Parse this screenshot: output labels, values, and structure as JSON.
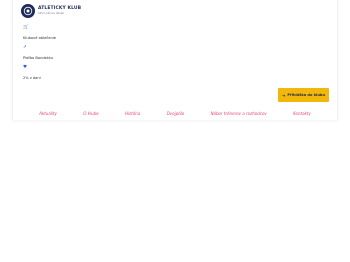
{
  "logo": {
    "title": "ATLETICKÝ KLUB",
    "subtitle": "SKV Lužnice Veselí"
  },
  "info": [
    {
      "icon": "shopping-cart-icon",
      "glyph": "🛒",
      "label": "Klubové oblečenie"
    },
    {
      "icon": "arrow-icon",
      "glyph": "↗",
      "label": "Plaťba Bandekku"
    },
    {
      "icon": "heart-icon",
      "glyph": "♥",
      "label": "2% z dani"
    }
  ],
  "join_button": {
    "label": "Přihláška do klubu",
    "arrow": "➜"
  },
  "nav": [
    "Aktuality",
    "O klube",
    "História",
    "Dvojpólo",
    "Nábor trénerov a rozhodcov",
    "Kontakty"
  ],
  "colors": {
    "brand": "#1f2a5c",
    "accent": "#f2b70c",
    "nav": "#e8417a"
  }
}
